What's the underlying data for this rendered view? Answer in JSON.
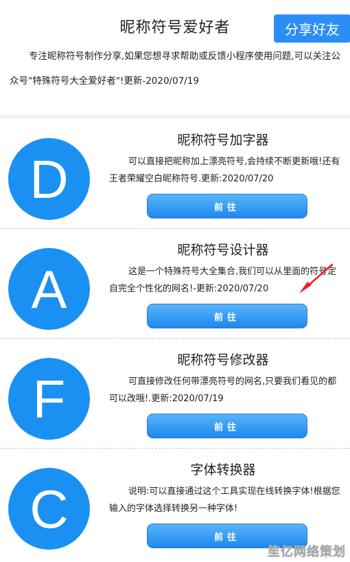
{
  "header": {
    "title": "昵称符号爱好者",
    "share_label": "分享好友",
    "intro": "专注昵称符号制作分享,如果您想寻求帮助或反馈小程序使用问题,可以关注公众号\"特殊符号大全爱好者\"!更新-2020/07/19"
  },
  "cards": [
    {
      "letter": "D",
      "title": "昵称符号加字器",
      "desc": "可以直接把昵称加上漂亮符号,会持续不断更新哦!还有王者荣耀空白昵称符号.更新:2020/07/20",
      "button": "前往"
    },
    {
      "letter": "A",
      "title": "昵称符号设计器",
      "desc": "这是一个特殊符号大全集合,我们可以从里面的符号定自完全个性化的网名!-更新:2020/07/20",
      "button": "前往"
    },
    {
      "letter": "F",
      "title": "昵称符号修改器",
      "desc": "可直接修改任何带漂亮符号的网名,只要我们看见的都可以改哦!.更新:2020/07/19",
      "button": "前往"
    },
    {
      "letter": "C",
      "title": "字体转换器",
      "desc": "说明:可以直接通过这个工具实现在线转换字体!根据您输入的字体选择转换另一种字体!",
      "button": "前往"
    }
  ],
  "watermark": "笙亿网络策划",
  "colors": {
    "accent": "#1a91f2",
    "share_button": "#2b8ef5",
    "annotation_arrow": "#e8202a"
  }
}
